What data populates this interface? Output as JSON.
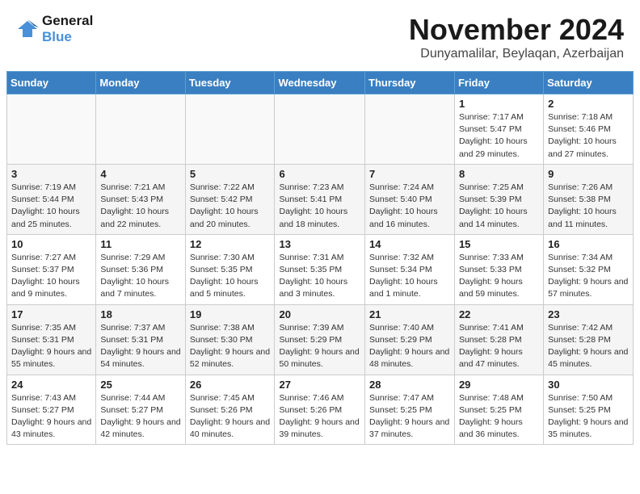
{
  "header": {
    "logo_line1": "General",
    "logo_line2": "Blue",
    "month_title": "November 2024",
    "location": "Dunyamalilar, Beylaqan, Azerbaijan"
  },
  "weekdays": [
    "Sunday",
    "Monday",
    "Tuesday",
    "Wednesday",
    "Thursday",
    "Friday",
    "Saturday"
  ],
  "weeks": [
    [
      {
        "day": "",
        "detail": ""
      },
      {
        "day": "",
        "detail": ""
      },
      {
        "day": "",
        "detail": ""
      },
      {
        "day": "",
        "detail": ""
      },
      {
        "day": "",
        "detail": ""
      },
      {
        "day": "1",
        "detail": "Sunrise: 7:17 AM\nSunset: 5:47 PM\nDaylight: 10 hours and 29 minutes."
      },
      {
        "day": "2",
        "detail": "Sunrise: 7:18 AM\nSunset: 5:46 PM\nDaylight: 10 hours and 27 minutes."
      }
    ],
    [
      {
        "day": "3",
        "detail": "Sunrise: 7:19 AM\nSunset: 5:44 PM\nDaylight: 10 hours and 25 minutes."
      },
      {
        "day": "4",
        "detail": "Sunrise: 7:21 AM\nSunset: 5:43 PM\nDaylight: 10 hours and 22 minutes."
      },
      {
        "day": "5",
        "detail": "Sunrise: 7:22 AM\nSunset: 5:42 PM\nDaylight: 10 hours and 20 minutes."
      },
      {
        "day": "6",
        "detail": "Sunrise: 7:23 AM\nSunset: 5:41 PM\nDaylight: 10 hours and 18 minutes."
      },
      {
        "day": "7",
        "detail": "Sunrise: 7:24 AM\nSunset: 5:40 PM\nDaylight: 10 hours and 16 minutes."
      },
      {
        "day": "8",
        "detail": "Sunrise: 7:25 AM\nSunset: 5:39 PM\nDaylight: 10 hours and 14 minutes."
      },
      {
        "day": "9",
        "detail": "Sunrise: 7:26 AM\nSunset: 5:38 PM\nDaylight: 10 hours and 11 minutes."
      }
    ],
    [
      {
        "day": "10",
        "detail": "Sunrise: 7:27 AM\nSunset: 5:37 PM\nDaylight: 10 hours and 9 minutes."
      },
      {
        "day": "11",
        "detail": "Sunrise: 7:29 AM\nSunset: 5:36 PM\nDaylight: 10 hours and 7 minutes."
      },
      {
        "day": "12",
        "detail": "Sunrise: 7:30 AM\nSunset: 5:35 PM\nDaylight: 10 hours and 5 minutes."
      },
      {
        "day": "13",
        "detail": "Sunrise: 7:31 AM\nSunset: 5:35 PM\nDaylight: 10 hours and 3 minutes."
      },
      {
        "day": "14",
        "detail": "Sunrise: 7:32 AM\nSunset: 5:34 PM\nDaylight: 10 hours and 1 minute."
      },
      {
        "day": "15",
        "detail": "Sunrise: 7:33 AM\nSunset: 5:33 PM\nDaylight: 9 hours and 59 minutes."
      },
      {
        "day": "16",
        "detail": "Sunrise: 7:34 AM\nSunset: 5:32 PM\nDaylight: 9 hours and 57 minutes."
      }
    ],
    [
      {
        "day": "17",
        "detail": "Sunrise: 7:35 AM\nSunset: 5:31 PM\nDaylight: 9 hours and 55 minutes."
      },
      {
        "day": "18",
        "detail": "Sunrise: 7:37 AM\nSunset: 5:31 PM\nDaylight: 9 hours and 54 minutes."
      },
      {
        "day": "19",
        "detail": "Sunrise: 7:38 AM\nSunset: 5:30 PM\nDaylight: 9 hours and 52 minutes."
      },
      {
        "day": "20",
        "detail": "Sunrise: 7:39 AM\nSunset: 5:29 PM\nDaylight: 9 hours and 50 minutes."
      },
      {
        "day": "21",
        "detail": "Sunrise: 7:40 AM\nSunset: 5:29 PM\nDaylight: 9 hours and 48 minutes."
      },
      {
        "day": "22",
        "detail": "Sunrise: 7:41 AM\nSunset: 5:28 PM\nDaylight: 9 hours and 47 minutes."
      },
      {
        "day": "23",
        "detail": "Sunrise: 7:42 AM\nSunset: 5:28 PM\nDaylight: 9 hours and 45 minutes."
      }
    ],
    [
      {
        "day": "24",
        "detail": "Sunrise: 7:43 AM\nSunset: 5:27 PM\nDaylight: 9 hours and 43 minutes."
      },
      {
        "day": "25",
        "detail": "Sunrise: 7:44 AM\nSunset: 5:27 PM\nDaylight: 9 hours and 42 minutes."
      },
      {
        "day": "26",
        "detail": "Sunrise: 7:45 AM\nSunset: 5:26 PM\nDaylight: 9 hours and 40 minutes."
      },
      {
        "day": "27",
        "detail": "Sunrise: 7:46 AM\nSunset: 5:26 PM\nDaylight: 9 hours and 39 minutes."
      },
      {
        "day": "28",
        "detail": "Sunrise: 7:47 AM\nSunset: 5:25 PM\nDaylight: 9 hours and 37 minutes."
      },
      {
        "day": "29",
        "detail": "Sunrise: 7:48 AM\nSunset: 5:25 PM\nDaylight: 9 hours and 36 minutes."
      },
      {
        "day": "30",
        "detail": "Sunrise: 7:50 AM\nSunset: 5:25 PM\nDaylight: 9 hours and 35 minutes."
      }
    ]
  ]
}
